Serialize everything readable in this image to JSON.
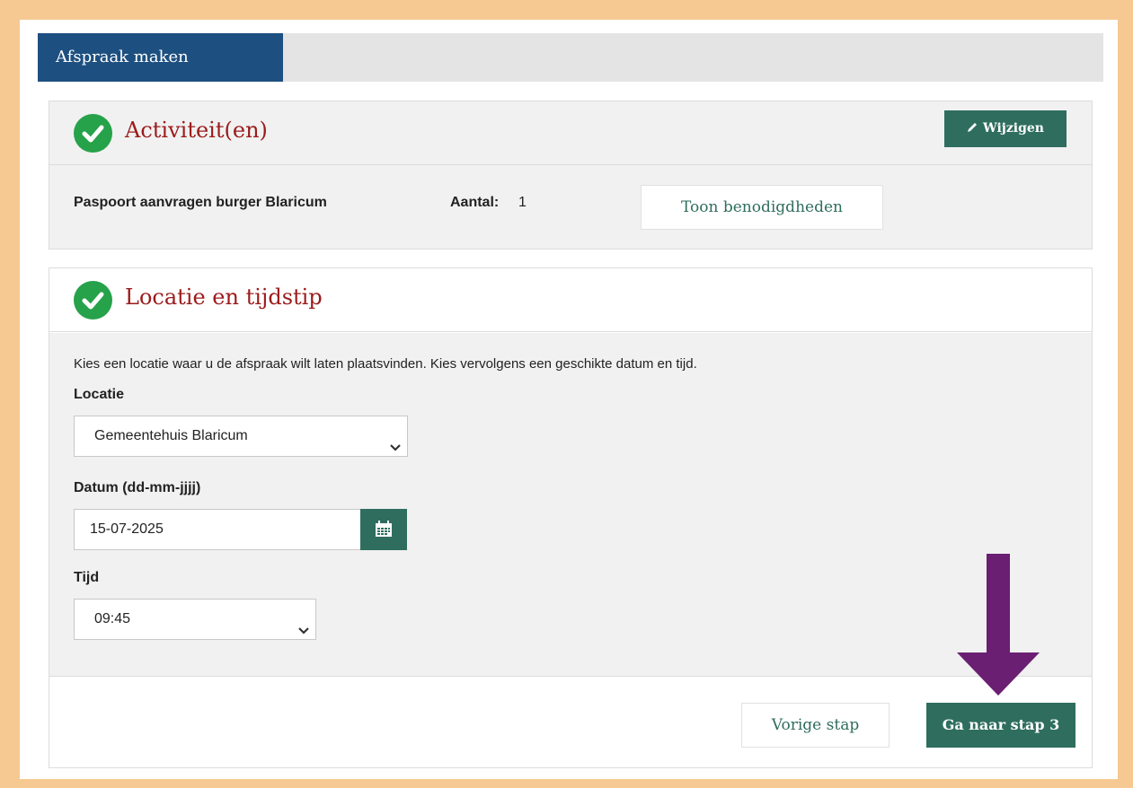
{
  "tabs": [
    {
      "label": "Afspraak maken",
      "active": true
    }
  ],
  "activities_section": {
    "title": "Activiteit(en)",
    "edit_label": "Wijzigen",
    "activity_name": "Paspoort aanvragen burger Blaricum",
    "quantity_label": "Aantal:",
    "quantity_value": "1",
    "show_requirements_label": "Toon benodigdheden"
  },
  "location_section": {
    "title": "Locatie en tijdstip",
    "intro": "Kies een locatie waar u de afspraak wilt laten plaatsvinden. Kies vervolgens een geschikte datum en tijd.",
    "location_label": "Locatie",
    "location_value": "Gemeentehuis Blaricum",
    "date_label": "Datum (dd-mm-jjjj)",
    "date_value": "15-07-2025",
    "time_label": "Tijd",
    "time_value": "09:45"
  },
  "footer": {
    "prev_label": "Vorige stap",
    "next_label": "Ga naar stap 3"
  },
  "colors": {
    "frame_border": "#f6c992",
    "tab_active": "#1d4f80",
    "button_green": "#2f6e5e",
    "title_red": "#9b1b1b",
    "check_green": "#26a24a",
    "arrow_purple": "#6a1f72"
  },
  "icons": {
    "check": "check-circle-icon",
    "edit": "pencil-icon",
    "select": "chevron-down-icon",
    "calendar": "calendar-icon",
    "annotation": "down-arrow-icon"
  }
}
